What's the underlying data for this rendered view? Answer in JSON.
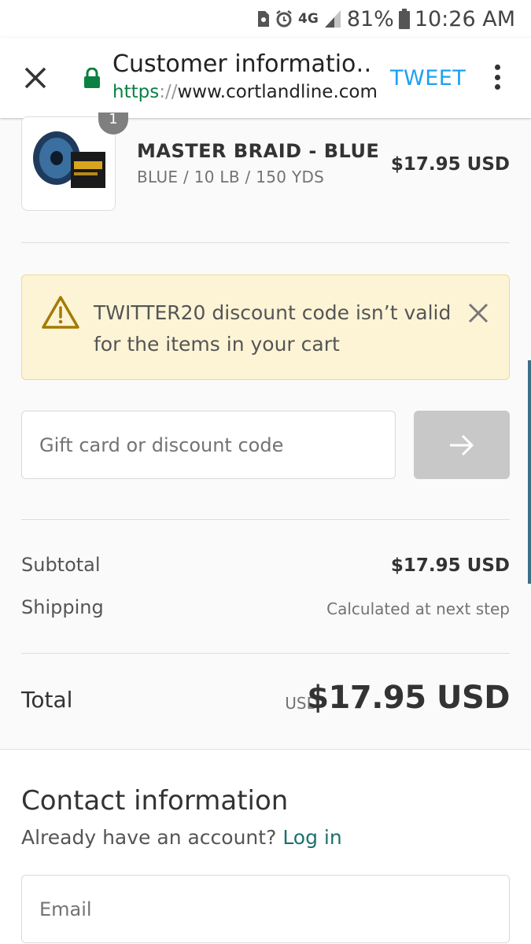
{
  "status_bar": {
    "network": "4G",
    "battery": "81%",
    "time": "10:26 AM"
  },
  "toolbar": {
    "title": "Customer informatio…",
    "url_scheme": "https",
    "url_sep": "://",
    "url_host": "www.cortlandline.com",
    "tweet_label": "TWEET"
  },
  "product": {
    "quantity": "1",
    "name": "MASTER BRAID - BLUE",
    "variant": "BLUE / 10 LB / 150 YDS",
    "price": "$17.95 USD"
  },
  "alert": {
    "message": "TWITTER20 discount code isn’t valid for the items in your cart"
  },
  "discount": {
    "placeholder": "Gift card or discount code"
  },
  "totals": {
    "subtotal_label": "Subtotal",
    "subtotal_value": "$17.95 USD",
    "shipping_label": "Shipping",
    "shipping_value": "Calculated at next step",
    "total_label": "Total",
    "total_currency": "USD",
    "total_value": "$17.95 USD"
  },
  "contact": {
    "heading": "Contact information",
    "account_prompt": "Already have an account?",
    "login_label": "Log in",
    "email_placeholder": "Email"
  },
  "colors": {
    "tweet": "#1da1f2",
    "secure_scheme": "#0b8043",
    "alert_bg": "#fdf4d6",
    "link": "#1c7070"
  }
}
